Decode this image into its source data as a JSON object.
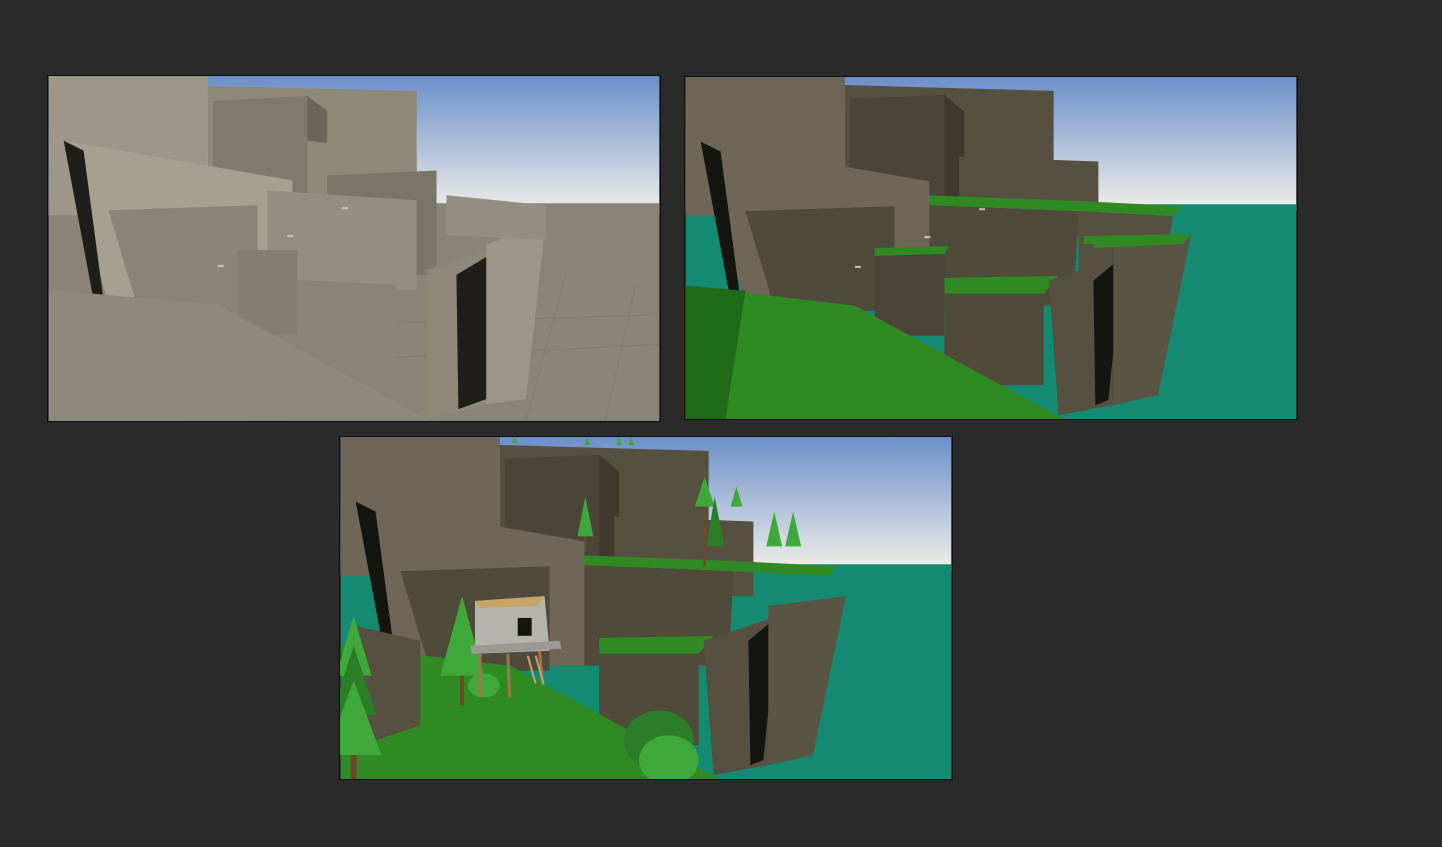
{
  "canvas": {
    "background": "#2a2a2a"
  },
  "panels": [
    {
      "stage": "greybox",
      "palette": {
        "sky_top": "#6b8fc9",
        "sky_bottom": "#f2f0ea",
        "ground": "#8a8478",
        "cliff_light": "#a6a091",
        "cliff_mid": "#8e8879",
        "cliff_dark": "#6b665a",
        "shadow": "#1f1e1a"
      }
    },
    {
      "stage": "grass-and-water",
      "palette": {
        "sky_top": "#6b8fc9",
        "sky_bottom": "#f2f0ea",
        "water": "#148a73",
        "grass": "#2f8a24",
        "grass_dark": "#1f6b18",
        "cliff_light": "#6e6657",
        "cliff_mid": "#55503f",
        "cliff_dark": "#3f3a2e",
        "shadow": "#151510"
      }
    },
    {
      "stage": "props-and-trees",
      "palette": {
        "sky_top": "#6b8fc9",
        "sky_bottom": "#f2f0ea",
        "water": "#148a73",
        "grass": "#2f8a24",
        "grass_dark": "#1f6b18",
        "cliff_light": "#6e6657",
        "cliff_mid": "#55503f",
        "cliff_dark": "#3f3a2e",
        "tree": "#3fa83a",
        "tree_dark": "#2b7d28",
        "hut_wall": "#b5b3ad",
        "hut_roof": "#c7a468",
        "stilts": "#a0754a",
        "shadow": "#151510"
      }
    }
  ]
}
